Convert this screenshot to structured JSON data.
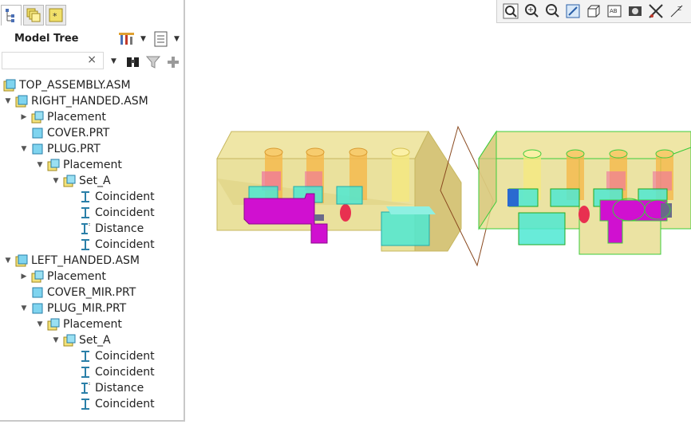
{
  "tabs": [
    {
      "icon": "model-tree-icon",
      "active": true
    },
    {
      "icon": "layers-icon",
      "active": false
    },
    {
      "icon": "favorites-icon",
      "active": false
    }
  ],
  "panel": {
    "title": "Model Tree",
    "settings_icon": "tree-settings-icon",
    "columns_icon": "tree-columns-icon",
    "search": {
      "value": "",
      "placeholder": ""
    },
    "search_clear": "×",
    "filter_dropdown": "▼",
    "find_icon": "binoculars-icon",
    "filter_icon": "filter-funnel-icon",
    "add_icon": "plus-icon"
  },
  "tree": [
    {
      "label": "TOP_ASSEMBLY.ASM",
      "level": 0,
      "twisty": "",
      "icon": "assembly"
    },
    {
      "label": "RIGHT_HANDED.ASM",
      "level": 0,
      "twisty": "▼",
      "icon": "assembly"
    },
    {
      "label": "Placement",
      "level": 1,
      "twisty": "▶",
      "icon": "placement"
    },
    {
      "label": "COVER.PRT",
      "level": 1,
      "twisty": "",
      "icon": "part"
    },
    {
      "label": "PLUG.PRT",
      "level": 1,
      "twisty": "▼",
      "icon": "part"
    },
    {
      "label": "Placement",
      "level": 2,
      "twisty": "▼",
      "icon": "placement"
    },
    {
      "label": "Set_A",
      "level": 3,
      "twisty": "▼",
      "icon": "placement"
    },
    {
      "label": "Coincident",
      "level": 4,
      "twisty": "",
      "icon": "coincident"
    },
    {
      "label": "Coincident",
      "level": 4,
      "twisty": "",
      "icon": "coincident"
    },
    {
      "label": "Distance",
      "level": 4,
      "twisty": "",
      "icon": "distance"
    },
    {
      "label": "Coincident",
      "level": 4,
      "twisty": "",
      "icon": "coincident"
    },
    {
      "label": "LEFT_HANDED.ASM",
      "level": 0,
      "twisty": "▼",
      "icon": "assembly"
    },
    {
      "label": "Placement",
      "level": 1,
      "twisty": "▶",
      "icon": "placement"
    },
    {
      "label": "COVER_MIR.PRT",
      "level": 1,
      "twisty": "",
      "icon": "part"
    },
    {
      "label": "PLUG_MIR.PRT",
      "level": 1,
      "twisty": "▼",
      "icon": "part"
    },
    {
      "label": "Placement",
      "level": 2,
      "twisty": "▼",
      "icon": "placement"
    },
    {
      "label": "Set_A",
      "level": 3,
      "twisty": "▼",
      "icon": "placement"
    },
    {
      "label": "Coincident",
      "level": 4,
      "twisty": "",
      "icon": "coincident"
    },
    {
      "label": "Coincident",
      "level": 4,
      "twisty": "",
      "icon": "coincident"
    },
    {
      "label": "Distance",
      "level": 4,
      "twisty": "",
      "icon": "distance"
    },
    {
      "label": "Coincident",
      "level": 4,
      "twisty": "",
      "icon": "coincident"
    }
  ],
  "view_toolbar": [
    {
      "name": "refit-icon"
    },
    {
      "name": "zoom-in-icon"
    },
    {
      "name": "zoom-out-icon"
    },
    {
      "name": "repaint-icon"
    },
    {
      "name": "display-style-icon"
    },
    {
      "name": "saved-orientations-icon"
    },
    {
      "name": "view-manager-icon"
    },
    {
      "name": "perspective-icon"
    },
    {
      "name": "datum-display-icon"
    }
  ],
  "colors": {
    "housing_fill": "#e6dc8c",
    "housing_edge": "#c7b760",
    "selected_edge": "#3ccc3c",
    "plug": "#d010d0",
    "cyan_block": "#4ee8d2",
    "pin_orange": "#f5b84a",
    "pin_red": "#e83050",
    "mirror_plane": "#8a4a20"
  }
}
